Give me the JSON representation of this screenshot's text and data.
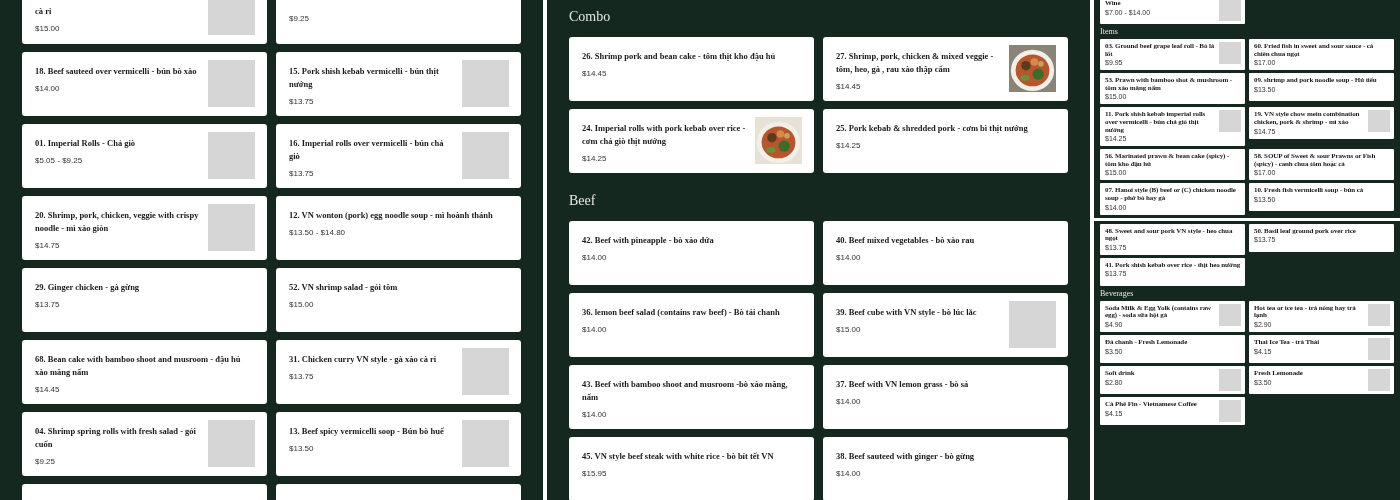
{
  "panels": [
    {
      "sections": [
        {
          "items": [
            {
              "title": "cà ri",
              "price": "$15.00",
              "kind": "placeholder"
            },
            {
              "price": "$9.25",
              "kind": "plain"
            },
            {
              "title": "18. Beef sauteed over vermicelli - bún bò xào",
              "price": "$14.00",
              "kind": "placeholder"
            },
            {
              "title": "15. Pork shish kebab vermicelli - bún thịt nướng",
              "price": "$13.75",
              "kind": "placeholder"
            },
            {
              "title": "01. Imperial Rolls - Chả giò",
              "price": "$5.05 - $9.25",
              "kind": "placeholder"
            },
            {
              "title": "16. Imperial rolls over vermicelli - bún chả giò",
              "price": "$13.75",
              "kind": "placeholder"
            },
            {
              "title": "20. Shrimp, pork, chicken, veggie with crispy noodle - mì xào giòn",
              "price": "$14.75",
              "kind": "placeholder"
            },
            {
              "title": "12. VN wonton (pork) egg noodle soup - mì hoành thánh",
              "price": "$13.50 - $14.80",
              "kind": "plain"
            },
            {
              "title": "29. Ginger chicken - gà gừng",
              "price": "$13.75",
              "kind": "plain"
            },
            {
              "title": "52. VN shrimp salad - gỏi tôm",
              "price": "$15.00",
              "kind": "plain"
            },
            {
              "title": "68. Bean cake with bamboo shoot and musroom - đậu hủ xào măng nấm",
              "price": "$14.45",
              "kind": "plain"
            },
            {
              "title": "31. Chicken curry VN style - gà xào cà ri",
              "price": "$13.75",
              "kind": "placeholder"
            },
            {
              "title": "04. Shrimp spring rolls with fresh salad - gỏi cuốn",
              "price": "$9.25",
              "kind": "placeholder"
            },
            {
              "title": "13. Beef spicy vermicelli soop - Bún bò huế",
              "price": "$13.50",
              "kind": "placeholder"
            },
            {
              "kind": "plain"
            },
            {
              "kind": "plain"
            }
          ]
        }
      ]
    },
    {
      "sections": [
        {
          "heading": "Combo",
          "items": [
            {
              "title": "26. Shrimp pork and bean cake - tôm thịt kho đậu hủ",
              "price": "$14.45",
              "kind": "plain"
            },
            {
              "title": "27. Shrimp, pork, chicken & mixed veggie - tôm, heo, gà , rau xào thập cẩm",
              "price": "$14.45"
            },
            {
              "title": "24. Imperial rolls with pork kebab over rice - cơm chả giò thịt nướng",
              "price": "$14.25"
            },
            {
              "title": "25. Pork kebab & shredded pork - cơm bì thịt nướng",
              "price": "$14.25",
              "kind": "plain"
            }
          ]
        },
        {
          "heading": "Beef",
          "items": [
            {
              "title": "42. Beef with pineapple - bò xào dứa",
              "price": "$14.00",
              "kind": "plain"
            },
            {
              "title": "40. Beef mixed vegetables - bò xào rau",
              "price": "$14.00",
              "kind": "plain"
            },
            {
              "title": "36. lemon beef salad (contains raw beef) - Bò tái chanh",
              "price": "$14.00",
              "kind": "plain"
            },
            {
              "title": "39. Beef cube with VN style - bò lúc lắc",
              "price": "$15.00",
              "kind": "placeholder"
            },
            {
              "title": "43. Beef with bamboo shoot and musroom -bò xào măng, nấm",
              "price": "$14.00",
              "kind": "plain"
            },
            {
              "title": "37. Beef with VN lemon grass - bò sả",
              "price": "$14.00",
              "kind": "plain"
            },
            {
              "title": "45. VN style beef steak with white rice - bò bít tết VN",
              "price": "$15.95",
              "kind": "plain"
            },
            {
              "title": "38. Beef sauteed with ginger - bò gừng",
              "price": "$14.00",
              "kind": "plain"
            }
          ]
        }
      ]
    },
    {
      "sections": [
        {
          "items": [
            {
              "title": "Wine",
              "price": "$7.00 - $14.00",
              "kind": "placeholder"
            }
          ]
        },
        {
          "heading": "Items",
          "items": [
            {
              "title": "03. Ground beef grape leaf roll - Bò lá lốt",
              "price": "$9.95",
              "kind": "placeholder"
            },
            {
              "title": "60. Fried fish in sweet and sour sauce - cá chiên chua ngọt",
              "price": "$17.00",
              "kind": "plain"
            },
            {
              "title": "53. Prawn with bamboo shot & mushroom - tôm xào măng nấm",
              "price": "$15.00",
              "kind": "plain"
            },
            {
              "title": "09. shrimp and pork noodle soup - Hủ tiếu",
              "price": "$13.50",
              "kind": "plain"
            },
            {
              "title": "11. Pork shish kebab imperial rolls over vermicelli - bún chả giò thịt nướng",
              "price": "$14.25",
              "kind": "placeholder"
            },
            {
              "title": "19. VN style chow mein combination chicken, pork & shrimp - mì xào",
              "price": "$14.75",
              "kind": "placeholder"
            },
            {
              "title": "56. Marinated prawn & bean cake (spicy) - tôm kho đậu hủ",
              "price": "$15.00",
              "kind": "plain"
            },
            {
              "title": "58. SOUP of Sweet & sour Prawns or Fish (spicy) - canh chua tôm hoặc cá",
              "price": "$17.00",
              "kind": "plain"
            },
            {
              "title": "07. Hanoi style (B) beef or (C) chicken noodle soup - phở bò hay gà",
              "price": "$14.00",
              "kind": "plain"
            },
            {
              "title": "10. Fresh fish vermicelli soup - bún cá",
              "price": "$13.50",
              "kind": "plain"
            }
          ]
        },
        {
          "seam": true,
          "items": [
            {
              "title": "48. Sweet and sour pork VN style - heo chua ngọt",
              "price": "$13.75",
              "kind": "plain"
            },
            {
              "title": "50. Basil leaf ground pork over rice",
              "price": "$13.75",
              "kind": "plain"
            },
            {
              "title": "41. Pork shish kebab over rice - thịt heo nướng",
              "price": "$13.75",
              "kind": "plain"
            }
          ]
        },
        {
          "heading": "Beverages",
          "items": [
            {
              "title": "Soda Milk & Egg Yolk (contains raw egg) - soda sữa hột gà",
              "price": "$4.90",
              "kind": "placeholder"
            },
            {
              "title": "Hot tea or ice tea - trà nóng hay trà lạnh",
              "price": "$2.90",
              "kind": "placeholder"
            },
            {
              "title": "Đá chanh - Fresh Lemonade",
              "price": "$3.50",
              "kind": "plain"
            },
            {
              "title": "Thai Ice Tea - trà Thái",
              "price": "$4.15",
              "kind": "placeholder"
            },
            {
              "title": "Soft drink",
              "price": "$2.80",
              "kind": "placeholder"
            },
            {
              "title": "Fresh Lemonade",
              "price": "$3.50",
              "kind": "placeholder"
            },
            {
              "title": "Cà Phê Fin - Vietnamese Coffee",
              "price": "$4.15",
              "kind": "placeholder"
            }
          ]
        }
      ]
    }
  ]
}
